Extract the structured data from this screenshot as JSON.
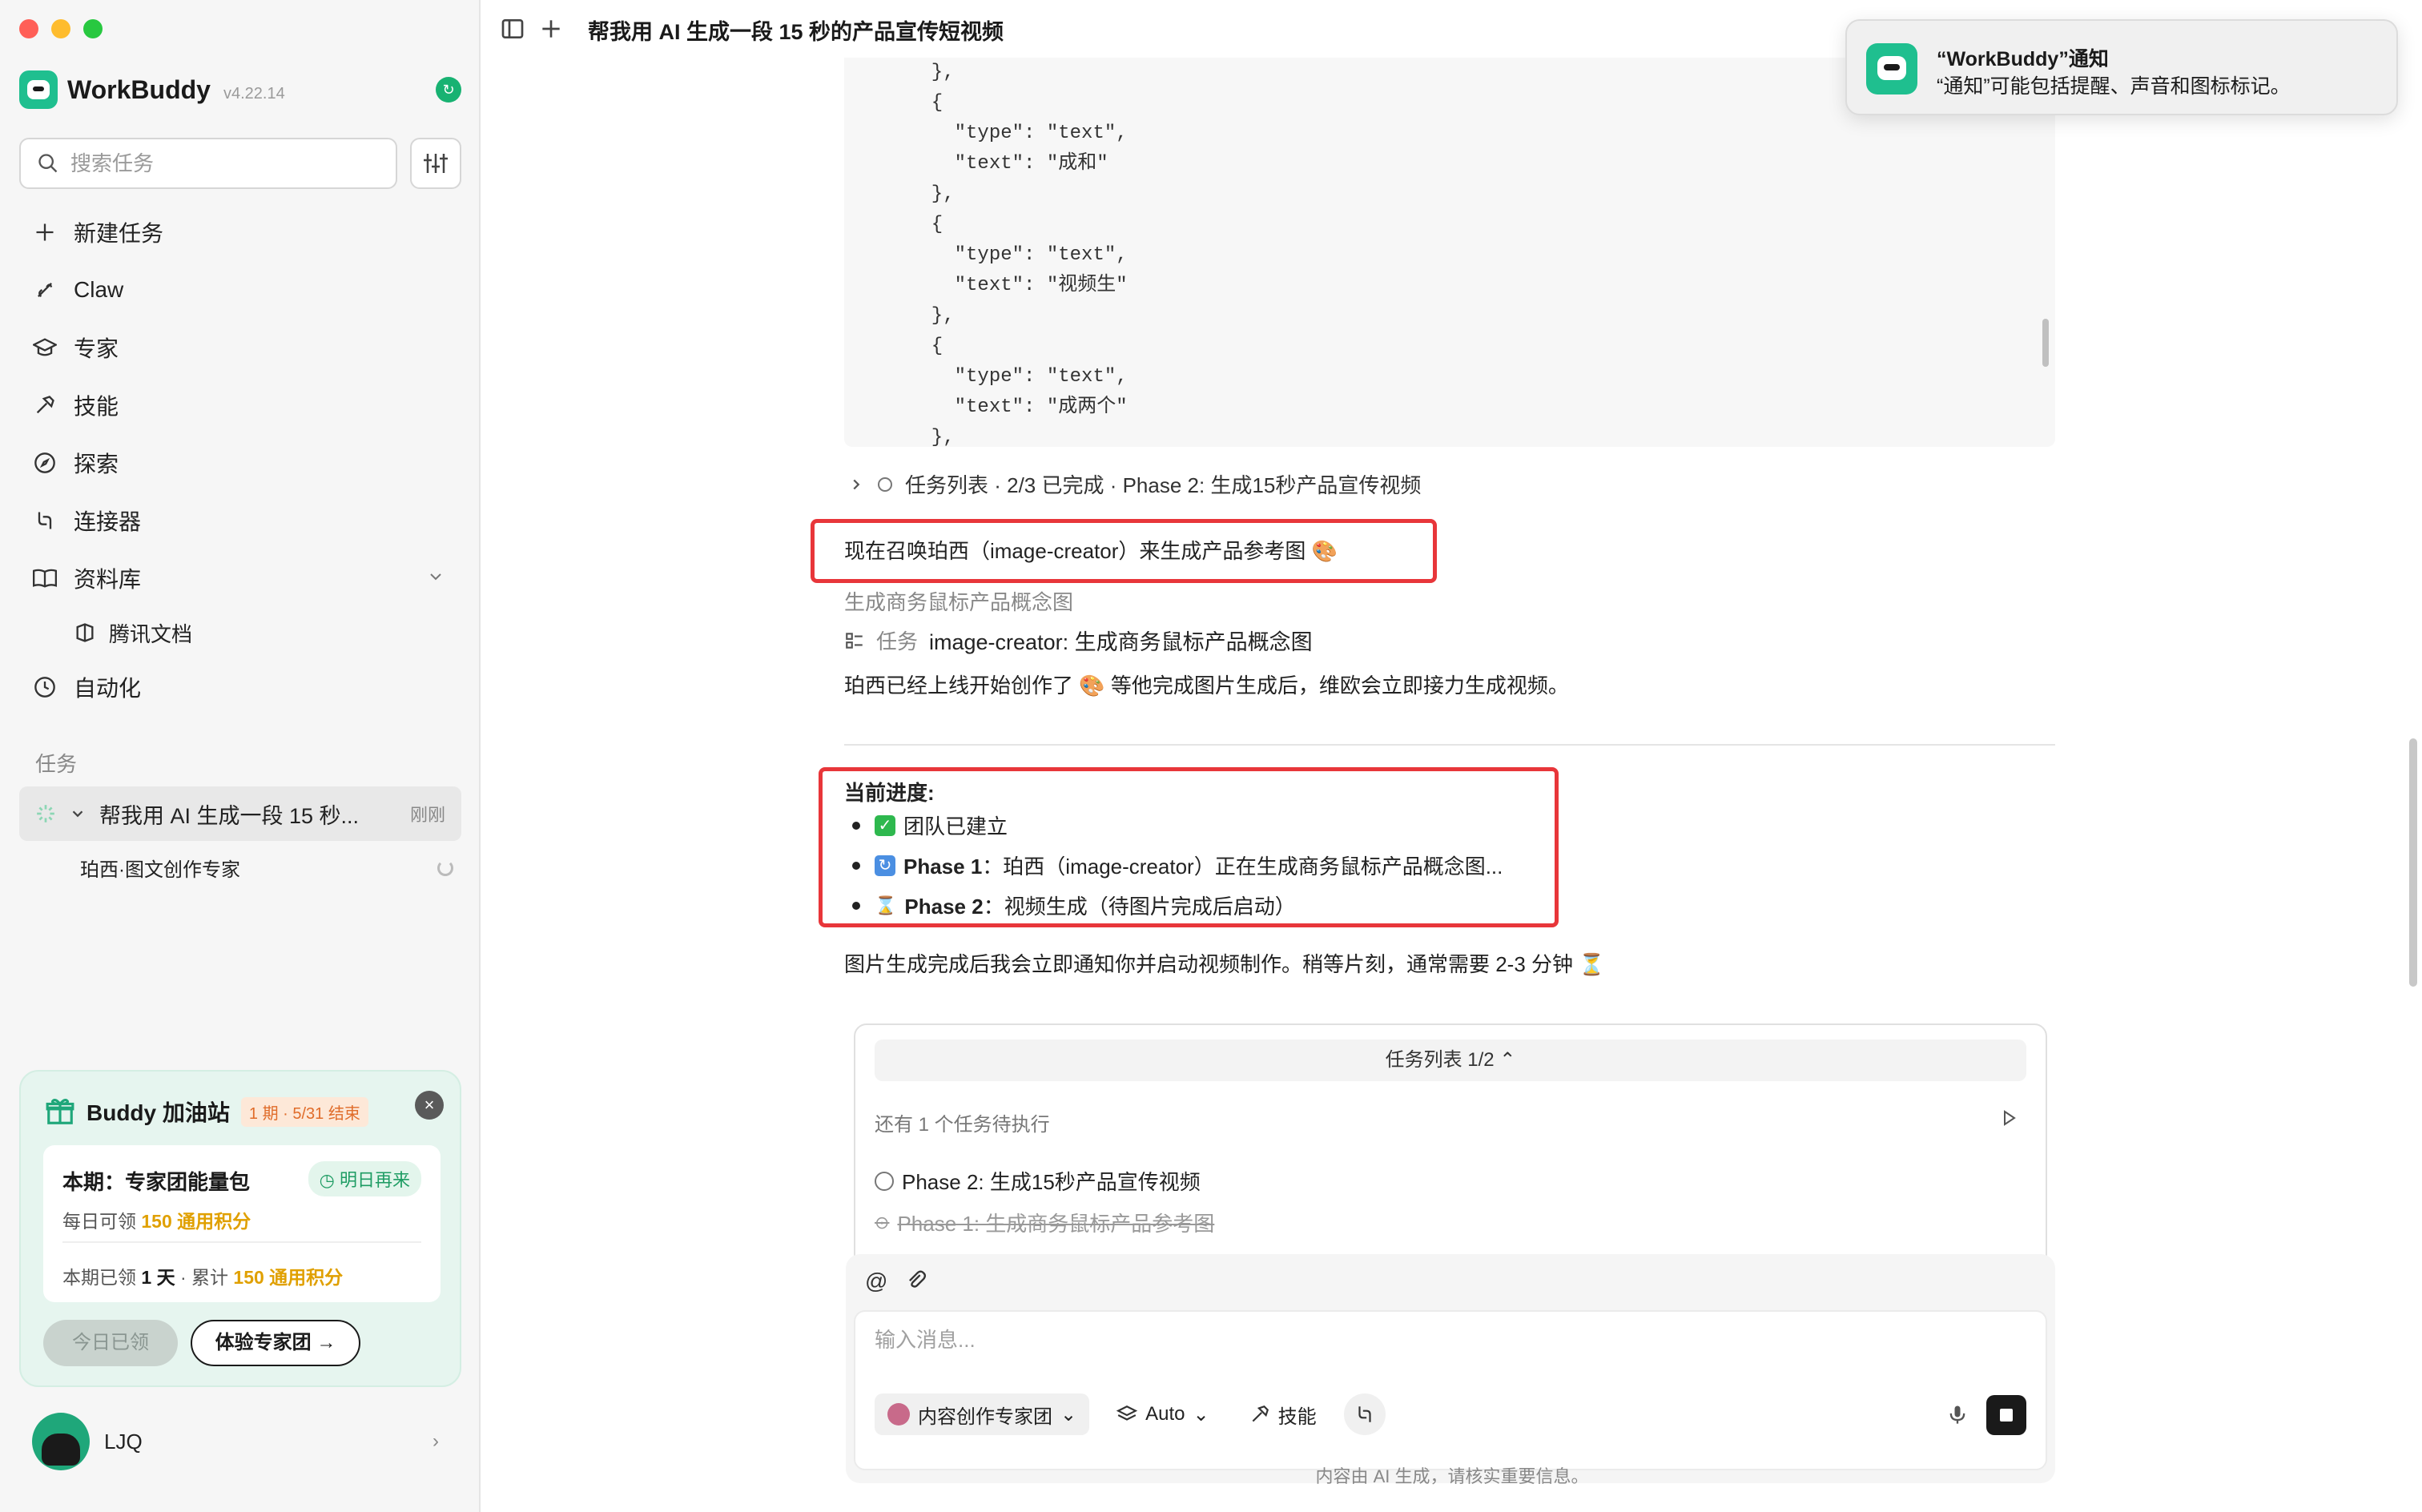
{
  "app": {
    "name": "WorkBuddy",
    "version": "v4.22.14"
  },
  "sidebar": {
    "search_placeholder": "搜索任务",
    "nav": [
      {
        "label": "新建任务",
        "icon": "plus-icon"
      },
      {
        "label": "Claw",
        "icon": "claw-icon"
      },
      {
        "label": "专家",
        "icon": "graduation-cap-icon"
      },
      {
        "label": "技能",
        "icon": "hammer-icon"
      },
      {
        "label": "探索",
        "icon": "compass-icon"
      },
      {
        "label": "连接器",
        "icon": "connector-icon"
      },
      {
        "label": "资料库",
        "icon": "book-icon"
      }
    ],
    "library_sub": "腾讯文档",
    "automation": "自动化",
    "tasks_section": "任务",
    "active_task": {
      "title": "帮我用 AI 生成一段 15 秒...",
      "time": "刚刚"
    },
    "sub_task": "珀西·图文创作专家"
  },
  "promo": {
    "title": "Buddy 加油站",
    "tag": "1 期 · 5/31 结束",
    "card_title": "本期：专家团能量包",
    "card_badge": "明日再来",
    "line1_prefix": "每日可领",
    "line1_value": "150 通用积分",
    "line2_prefix": "本期已领",
    "line2_days": "1 天",
    "line2_mid": "· 累计",
    "line2_value": "150 通用积分",
    "btn_claimed": "今日已领",
    "btn_try": "体验专家团 →"
  },
  "user": {
    "name": "LJQ"
  },
  "header": {
    "title": "帮我用 AI 生成一段 15 秒的产品宣传短视频"
  },
  "code": {
    "lines": [
      "  },",
      "  {",
      "    \"type\": \"text\",",
      "    \"text\": \"成和\"",
      "  },",
      "  {",
      "    \"type\": \"text\",",
      "    \"text\": \"视频生\"",
      "  },",
      "  {",
      "    \"type\": \"text\",",
      "    \"text\": \"成两个\"",
      "  },"
    ]
  },
  "chat": {
    "task_collapsed": "任务列表 · 2/3 已完成 · Phase 2: 生成15秒产品宣传视频",
    "summon": "现在召唤珀西（image-creator）来生成产品参考图 🎨",
    "gen_concept": "生成商务鼠标产品概念图",
    "task_label": "任务",
    "task_detail": "image-creator: 生成商务鼠标产品概念图",
    "online": "珀西已经上线开始创作了 🎨 等他完成图片生成后，维欧会立即接力生成视频。",
    "progress_title": "当前进度:",
    "progress": [
      {
        "emoji": "✅",
        "strong": "",
        "text": "团队已建立"
      },
      {
        "emoji": "🔄",
        "strong": "Phase 1",
        "text": "：珀西（image-creator）正在生成商务鼠标产品概念图..."
      },
      {
        "emoji": "⏳",
        "strong": "Phase 2",
        "text": "：视频生成（待图片完成后启动）"
      }
    ],
    "after": "图片生成完成后我会立即通知你并启动视频制作。稍等片刻，通常需要 2-3 分钟 ⏳"
  },
  "tasklist": {
    "header": "任务列表 1/2",
    "pending": "还有 1 个任务待执行",
    "item1": "Phase 2: 生成15秒产品宣传视频",
    "item2": "Phase 1: 生成商务鼠标产品参考图"
  },
  "composer": {
    "placeholder": "输入消息...",
    "agent": "内容创作专家团",
    "model": "Auto",
    "skills": "技能"
  },
  "disclaimer": "内容由 AI 生成，请核实重要信息。",
  "notification": {
    "title": "“WorkBuddy”通知",
    "body": "“通知”可能包括提醒、声音和图标标记。"
  }
}
